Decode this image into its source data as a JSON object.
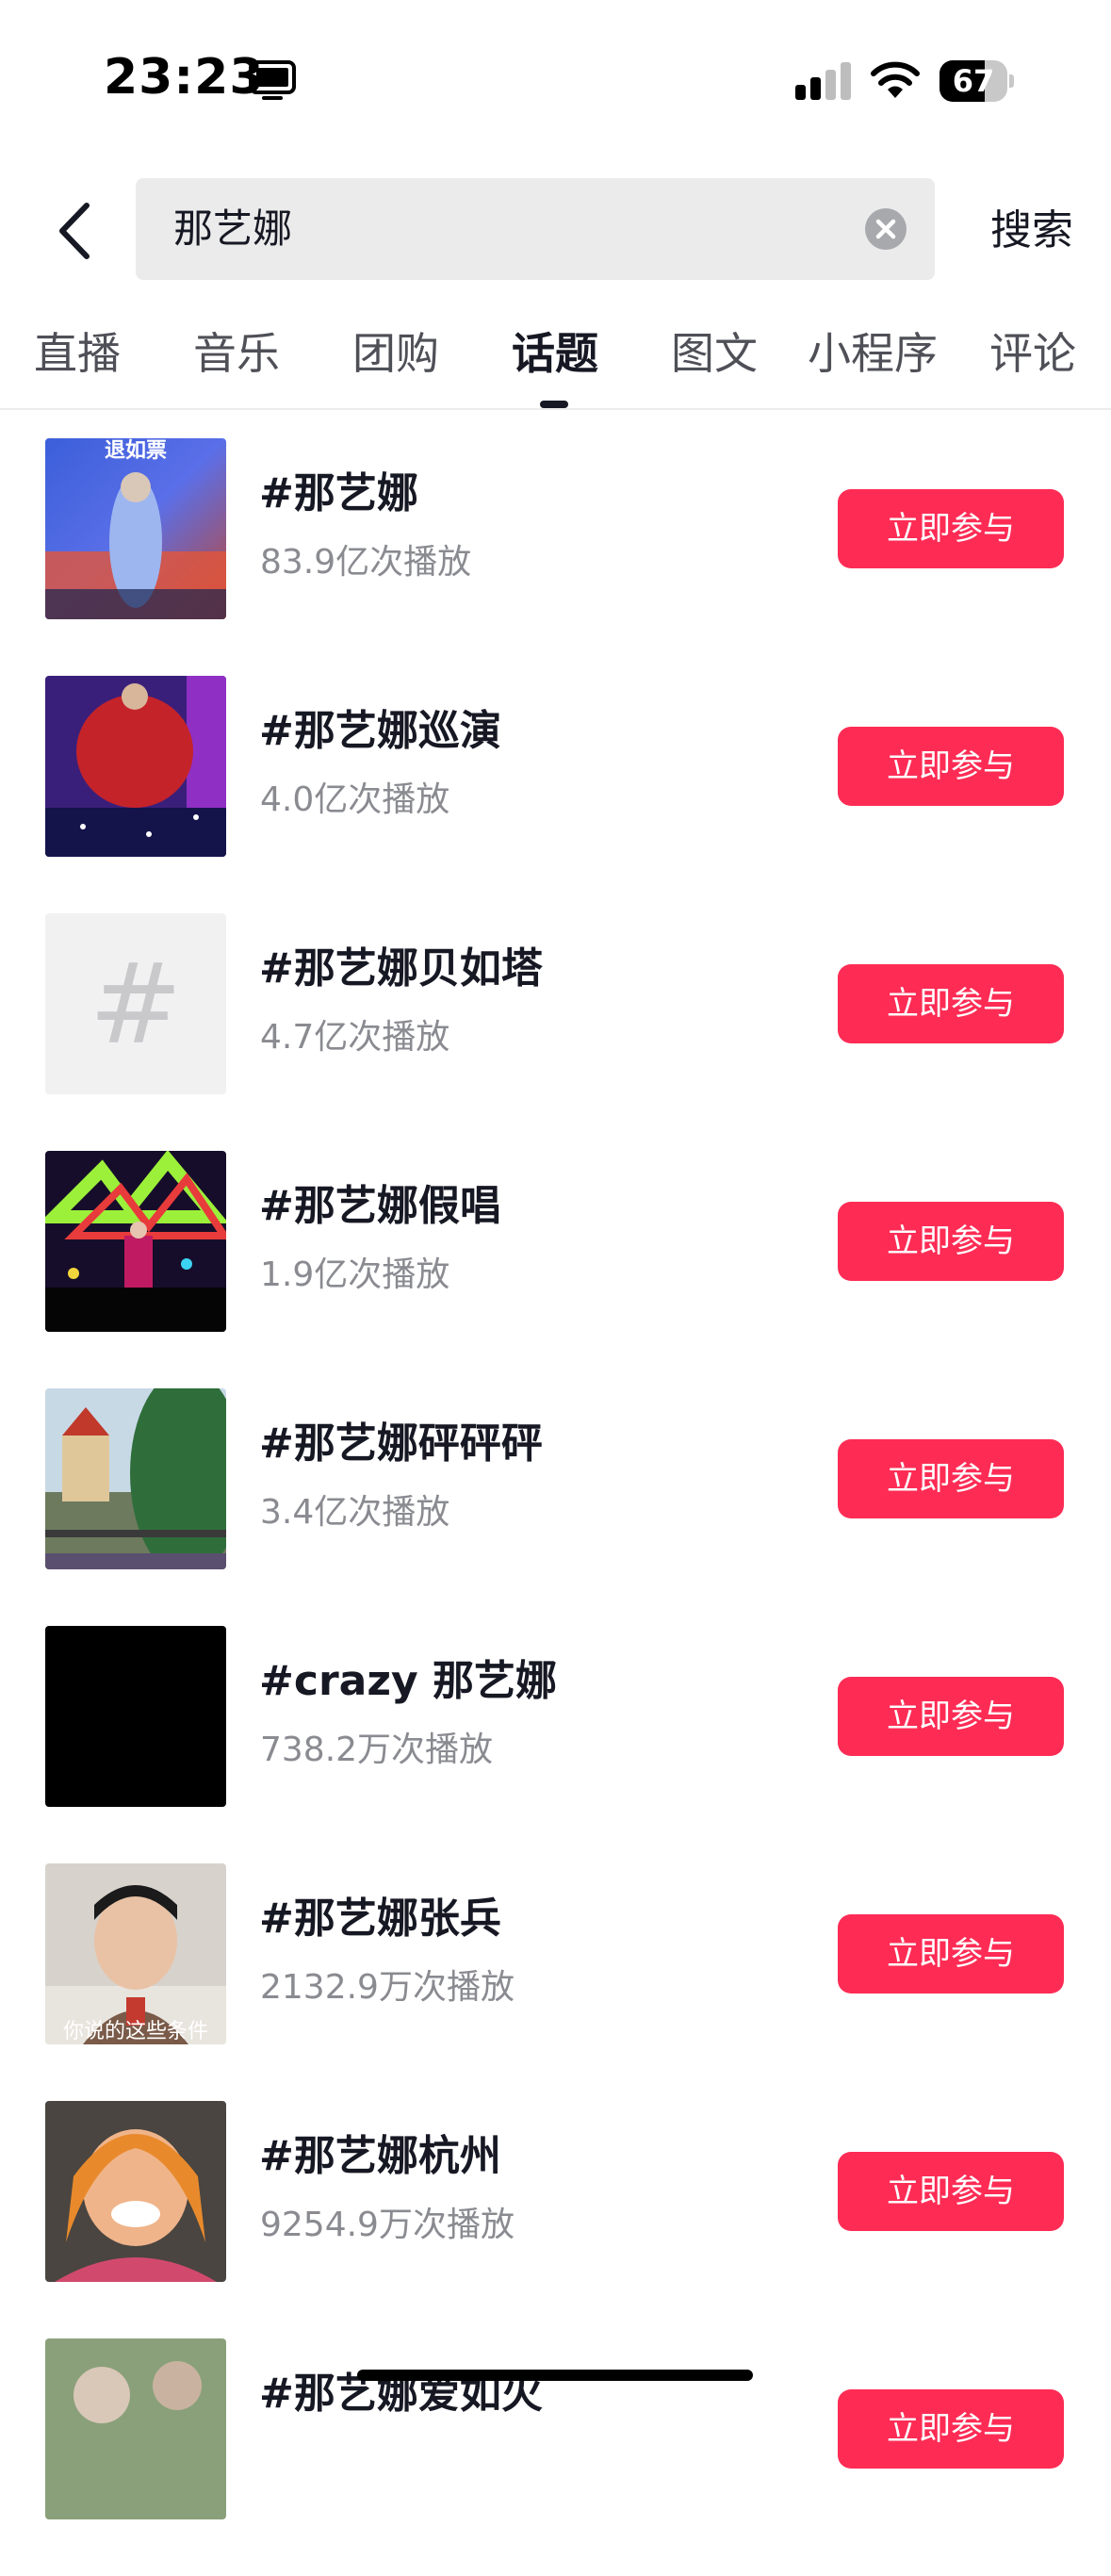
{
  "status_bar": {
    "time": "23:23",
    "battery": "67",
    "battery_level": 0.67,
    "icons": [
      "screen-mirroring-icon",
      "cellular-signal-icon",
      "wifi-icon",
      "battery-icon"
    ]
  },
  "search": {
    "query": "那艺娜",
    "submit_label": "搜索",
    "icons": [
      "back-chevron-icon",
      "clear-icon"
    ]
  },
  "tabs": [
    {
      "label": "直播",
      "active": false
    },
    {
      "label": "音乐",
      "active": false
    },
    {
      "label": "团购",
      "active": false
    },
    {
      "label": "话题",
      "active": true
    },
    {
      "label": "图文",
      "active": false
    },
    {
      "label": "小程序",
      "active": false
    },
    {
      "label": "评论",
      "active": false
    }
  ],
  "topics": [
    {
      "title": "#那艺娜",
      "views": "83.9亿次播放",
      "button": "立即参与",
      "thumbnail": "stage-concert",
      "thumbnail_text": "退如票"
    },
    {
      "title": "#那艺娜巡演",
      "views": "4.0亿次播放",
      "button": "立即参与",
      "thumbnail": "red-dress-stage"
    },
    {
      "title": "#那艺娜贝如塔",
      "views": "4.7亿次播放",
      "button": "立即参与",
      "thumbnail": "hashtag-placeholder",
      "thumbnail_text": "#"
    },
    {
      "title": "#那艺娜假唱",
      "views": "1.9亿次播放",
      "button": "立即参与",
      "thumbnail": "neon-stage"
    },
    {
      "title": "#那艺娜砰砰砰",
      "views": "3.4亿次播放",
      "button": "立即参与",
      "thumbnail": "theme-park"
    },
    {
      "title": "#crazy 那艺娜",
      "views": "738.2万次播放",
      "button": "立即参与",
      "thumbnail": "black"
    },
    {
      "title": "#那艺娜张兵",
      "views": "2132.9万次播放",
      "button": "立即参与",
      "thumbnail": "man-portrait",
      "thumbnail_text": "你说的这些条件"
    },
    {
      "title": "#那艺娜杭州",
      "views": "9254.9万次播放",
      "button": "立即参与",
      "thumbnail": "woman-portrait"
    },
    {
      "title": "#那艺娜爱如火",
      "views": "",
      "button": "立即参与",
      "thumbnail": "crowd-outdoor"
    }
  ],
  "colors": {
    "accent": "#fe2c55",
    "text_primary": "#161823",
    "text_secondary": "#8a8b91",
    "search_bg": "#ebebeb"
  }
}
